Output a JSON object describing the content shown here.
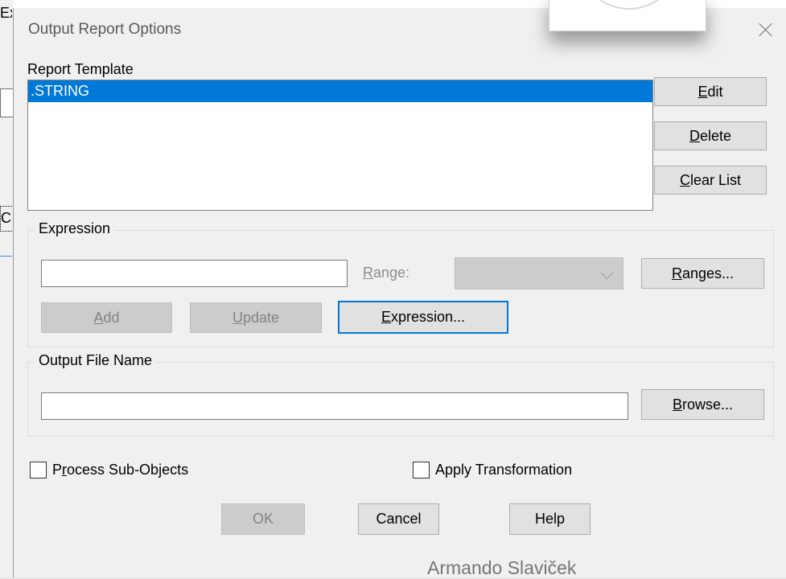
{
  "background": {
    "fragments": [
      "Ex",
      "C"
    ]
  },
  "dialog": {
    "title": "Output Report Options",
    "report_template": {
      "label": "Report Template",
      "items": [
        ".STRING"
      ],
      "selected_index": 0
    },
    "buttons": {
      "edit": {
        "pre": "",
        "key": "E",
        "post": "dit"
      },
      "delete": {
        "pre": "",
        "key": "D",
        "post": "elete"
      },
      "clear_list": {
        "pre": "",
        "key": "C",
        "post": "lear List"
      }
    },
    "expression_group": {
      "legend": "Expression",
      "input_value": "",
      "range_label": {
        "key": "R",
        "post": "ange:"
      },
      "range_value": "",
      "ranges_button": {
        "pre": "",
        "key": "R",
        "post": "anges..."
      },
      "add_button": {
        "pre": "",
        "key": "A",
        "post": "dd"
      },
      "update_button": {
        "pre": "",
        "key": "U",
        "post": "pdate"
      },
      "expression_button": {
        "pre": "",
        "key": "E",
        "post": "xpression..."
      }
    },
    "output_group": {
      "legend": "Output File Name",
      "file_value": "",
      "browse_button": {
        "pre": "",
        "key": "B",
        "post": "rowse..."
      }
    },
    "process_sub_objects": {
      "pre": "P",
      "key": "r",
      "post": "ocess Sub-Objects",
      "checked": false
    },
    "apply_transformation": {
      "label": "Apply Transformation",
      "checked": false
    },
    "footer": {
      "ok": "OK",
      "cancel": "Cancel",
      "help": "Help"
    }
  },
  "watermark": "Armando Slaviček",
  "colors": {
    "dialog_bg": "#f0f0f0",
    "selection": "#0078d7",
    "button_bg": "#e1e1e1",
    "disabled_bg": "#cccccc"
  }
}
